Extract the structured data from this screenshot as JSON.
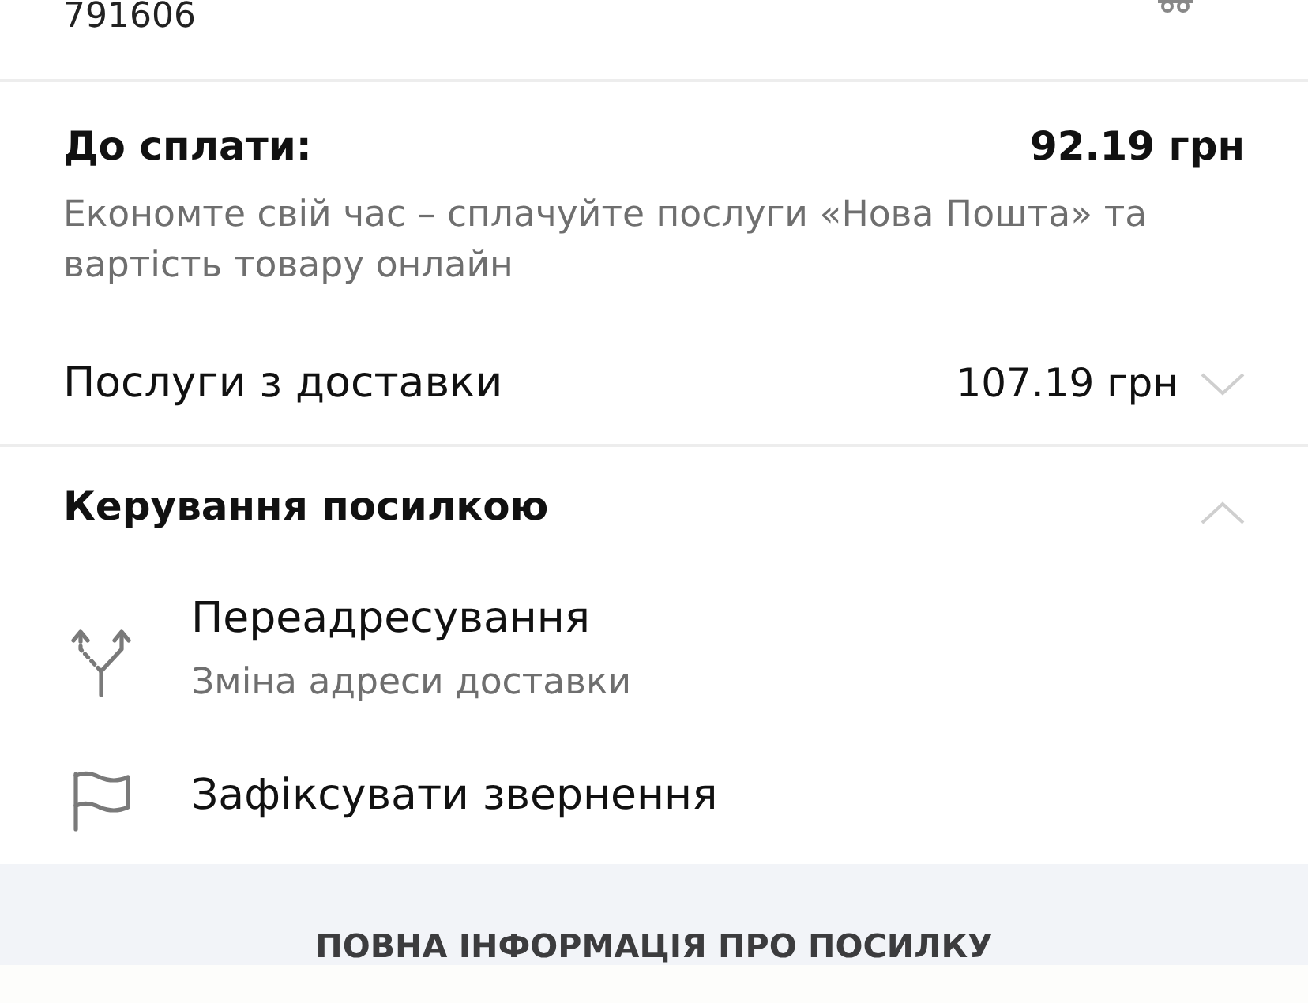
{
  "header": {
    "number": "791606"
  },
  "payment": {
    "label": "До сплати:",
    "amount": "92.19 грн",
    "note": "Економте свій час – сплачуйте послуги «Нова Пошта» та вартість товару онлайн"
  },
  "sections": [
    {
      "kind": "amount",
      "title": "Послуги з доставки",
      "amount": "107.19 грн",
      "expanded": false
    },
    {
      "kind": "group",
      "title": "Керування посилкою",
      "expanded": true,
      "items": [
        {
          "kind": "redirect",
          "title": "Переадресування",
          "subtitle": "Зміна адреси доставки"
        },
        {
          "kind": "report",
          "title": "Зафіксувати звернення"
        }
      ]
    }
  ],
  "footer_button": "ПОВНА ІНФОРМАЦІЯ ПРО ПОСИЛКУ"
}
